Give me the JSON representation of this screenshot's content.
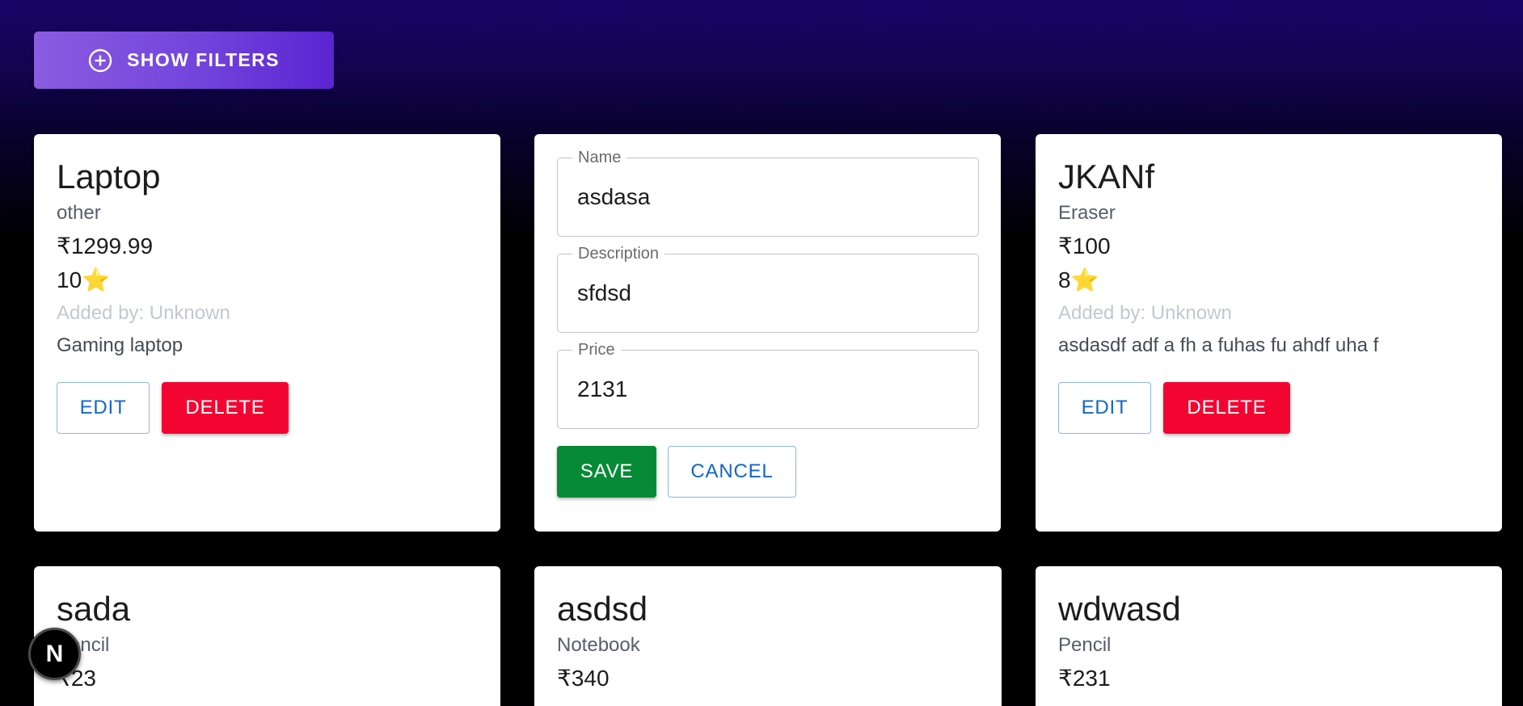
{
  "filters": {
    "label": "SHOW FILTERS",
    "icon": "plus-circle-icon"
  },
  "buttons": {
    "edit": "EDIT",
    "delete": "DELETE",
    "save": "SAVE",
    "cancel": "CANCEL"
  },
  "colors": {
    "delete": "#f30532",
    "save": "#068a36",
    "outline_text": "#1266c8",
    "filters_button": "#7344dc"
  },
  "products": [
    {
      "title": "Laptop",
      "category": "other",
      "price": "₹1299.99",
      "rating": "10",
      "added_by": "Added by: Unknown",
      "description": "Gaming laptop"
    },
    {
      "title": "JKANf",
      "category": "Eraser",
      "price": "₹100",
      "rating": "8",
      "added_by": "Added by: Unknown",
      "description": "asdasdf adf a fh a fuhas fu ahdf uha f"
    },
    {
      "title": "sada",
      "category": "Pencil",
      "price": "₹23"
    },
    {
      "title": "asdsd",
      "category": "Notebook",
      "price": "₹340"
    },
    {
      "title": "wdwasd",
      "category": "Pencil",
      "price": "₹231"
    }
  ],
  "edit_form": {
    "name": {
      "label": "Name",
      "value": "asdasa"
    },
    "description": {
      "label": "Description",
      "value": "sfdsd"
    },
    "price": {
      "label": "Price",
      "value": "2131"
    }
  },
  "badge": {
    "letter": "N"
  }
}
